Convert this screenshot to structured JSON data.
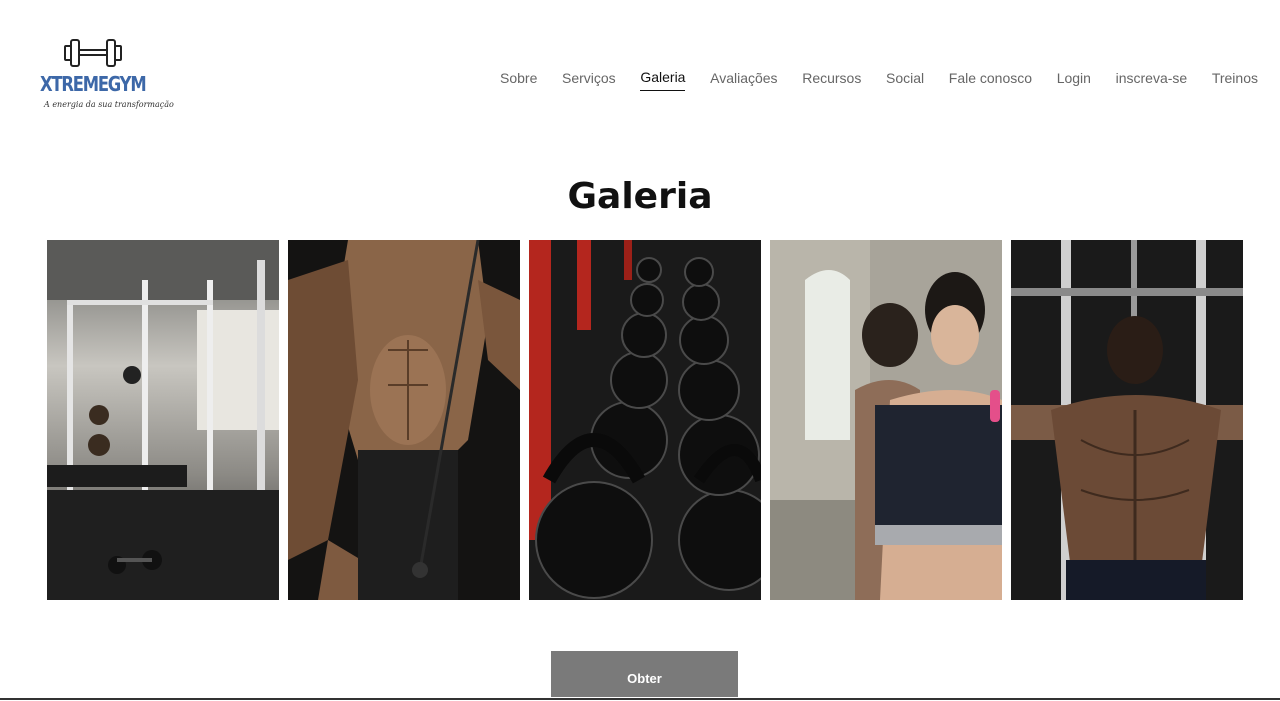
{
  "brand": {
    "name": "XTREMEGYM",
    "tagline": "A energia da sua transformação",
    "color": "#3d68a8"
  },
  "nav": {
    "items": [
      {
        "label": "Sobre",
        "active": false
      },
      {
        "label": "Serviços",
        "active": false
      },
      {
        "label": "Galeria",
        "active": true
      },
      {
        "label": "Avaliações",
        "active": false
      },
      {
        "label": "Recursos",
        "active": false
      },
      {
        "label": "Social",
        "active": false
      },
      {
        "label": "Fale conosco",
        "active": false
      },
      {
        "label": "Login",
        "active": false
      },
      {
        "label": "inscreva-se",
        "active": false
      },
      {
        "label": "Treinos",
        "active": false
      }
    ]
  },
  "gallery": {
    "title": "Galeria",
    "images": [
      {
        "subject": "gym-interior-photo"
      },
      {
        "subject": "cable-curl-athlete-photo"
      },
      {
        "subject": "kettlebells-photo"
      },
      {
        "subject": "women-training-photo"
      },
      {
        "subject": "back-lat-pulldown-photo"
      }
    ]
  },
  "cta": {
    "label": "Obter",
    "background": "#7a7a7a"
  }
}
